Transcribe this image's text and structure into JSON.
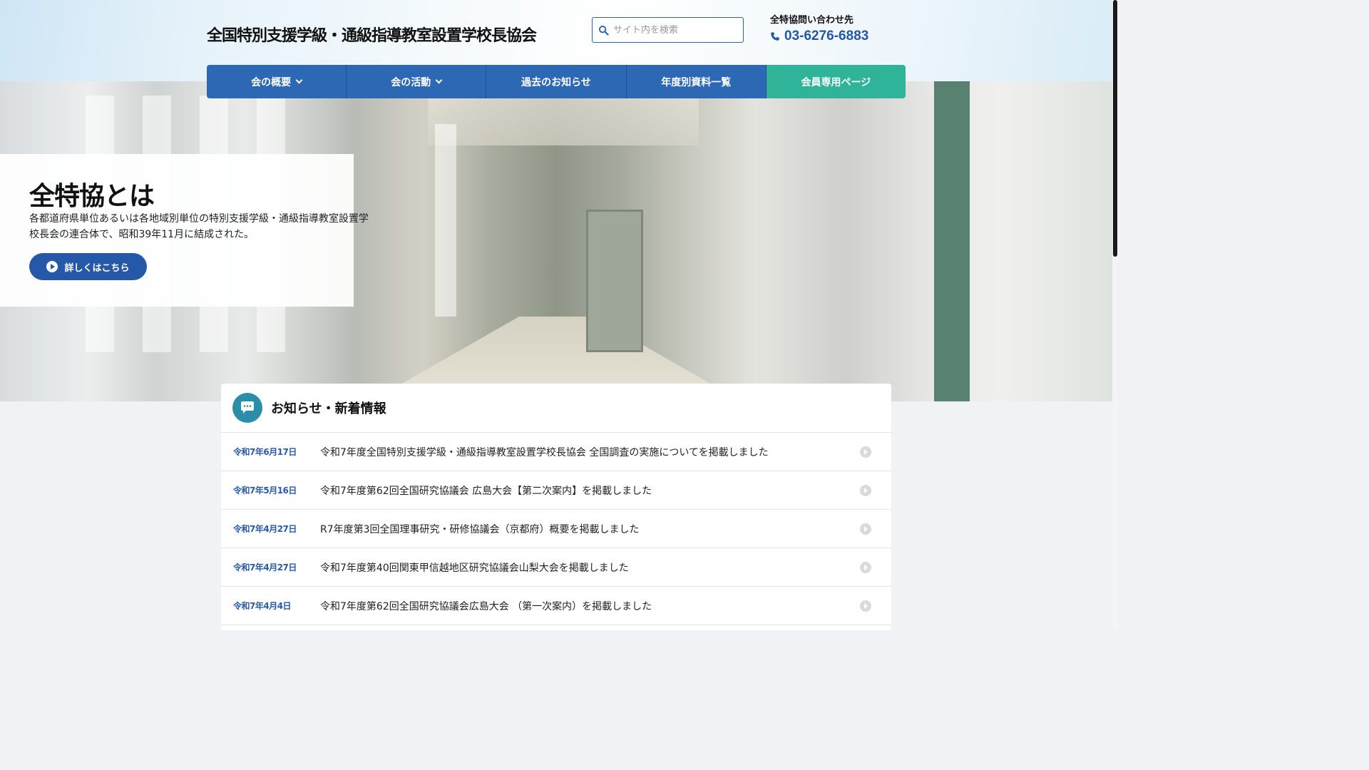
{
  "header": {
    "site_title": "全国特別支援学級・通級指導教室設置学校長協会",
    "search_placeholder": "サイト内を検索",
    "contact_label": "全特協問い合わせ先",
    "contact_phone": "03-6276-6883"
  },
  "nav": {
    "items": [
      {
        "label": "会の概要"
      },
      {
        "label": "会の活動"
      },
      {
        "label": "過去のお知らせ"
      },
      {
        "label": "年度別資料一覧"
      },
      {
        "label": "会員専用ページ"
      }
    ]
  },
  "hero": {
    "title": "全特協とは",
    "text": "各都道府県単位あるいは各地域別単位の特別支援学級・通級指導教室設置学校長会の連合体で、昭和39年11月に結成された。",
    "button_label": "詳しくはこちら"
  },
  "news": {
    "title": "お知らせ・新着情報",
    "items": [
      {
        "date": "令和7年6月17日",
        "text": "令和7年度全国特別支援学級・通級指導教室設置学校長協会 全国調査の実施についてを掲載しました"
      },
      {
        "date": "令和7年5月16日",
        "text": "令和7年度第62回全国研究協議会 広島大会【第二次案内】を掲載しました"
      },
      {
        "date": "令和7年4月27日",
        "text": "R7年度第3回全国理事研究・研修協議会（京都府）概要を掲載しました"
      },
      {
        "date": "令和7年4月27日",
        "text": "令和7年度第40回関東甲信越地区研究協議会山梨大会を掲載しました"
      },
      {
        "date": "令和7年4月4日",
        "text": "令和7年度第62回全国研究協議会広島大会 （第一次案内）を掲載しました"
      }
    ]
  },
  "colors": {
    "nav_blue": "#2c68b4",
    "nav_member": "#2fb49a",
    "accent_blue": "#2558a8",
    "news_date": "#2a5ba6"
  }
}
